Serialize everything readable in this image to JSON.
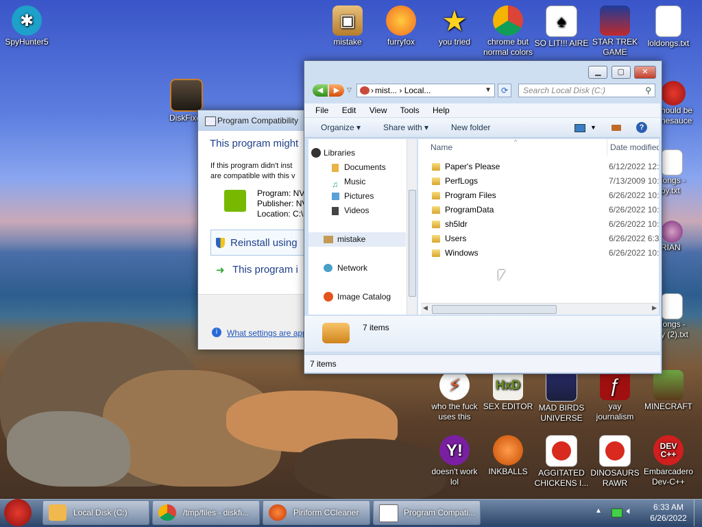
{
  "desktop_icons": {
    "spyhunter": "SpyHunter5",
    "diskfixer": "DiskFixer",
    "mistake": "mistake",
    "furryfox": "furryfox",
    "you_tried": "you tried",
    "chrome": "chrome but\nnormal colors",
    "solitaire": "SO LIT!!! AIRE",
    "star_trek": "STAR TREK\nGAME",
    "loldongs": "loldongs.txt",
    "should_be": "hould be\nnesauce",
    "loldongs_copy": "longs -\npy.txt",
    "brian": "RIAN",
    "loldongs_copy2": "longs -\ny (2).txt",
    "who_fuck": "who the fuck\nuses this",
    "sex_editor": "SEX EDITOR",
    "mad_birds": "MAD BIRDS\nUNIVERSE",
    "yay": "yay\njournalism",
    "minecraft": "MINECRAFT",
    "doesnt_work": "doesn't work\nlol",
    "inkballs": "INKBALLS",
    "aggitated": "AGGITATED\nCHICKENS I...",
    "dinosaurs": "DINOSAURS\nRAWR",
    "devcpp": "Embarcadero\nDev-C++",
    "devcpp_logo": "DEV\nC++"
  },
  "compat": {
    "title": "Program Compatibility",
    "heading": "This program might",
    "desc": "If this program didn't inst\nare compatible with this v",
    "program": "Program: NV",
    "publisher": "Publisher: NV",
    "location": "Location: C:\\",
    "reinstall": "Reinstall using",
    "installed": "This program i",
    "settings_link": "What settings are app"
  },
  "explorer": {
    "address": [
      "mist...",
      "Local..."
    ],
    "search_placeholder": "Search Local Disk (C:)",
    "menu": [
      "File",
      "Edit",
      "View",
      "Tools",
      "Help"
    ],
    "toolbar": {
      "organize": "Organize",
      "share": "Share with",
      "newfolder": "New folder"
    },
    "nav": {
      "libraries": "Libraries",
      "documents": "Documents",
      "music": "Music",
      "pictures": "Pictures",
      "videos": "Videos",
      "mistake": "mistake",
      "network": "Network",
      "catalog": "Image Catalog"
    },
    "columns": {
      "name": "Name",
      "date": "Date modified"
    },
    "files": [
      {
        "name": "Paper's Please",
        "date": "6/12/2022 12:"
      },
      {
        "name": "PerfLogs",
        "date": "7/13/2009 10:"
      },
      {
        "name": "Program Files",
        "date": "6/26/2022 10:"
      },
      {
        "name": "ProgramData",
        "date": "6/26/2022 10:"
      },
      {
        "name": "sh5ldr",
        "date": "6/26/2022 10:"
      },
      {
        "name": "Users",
        "date": "6/26/2022 6:3"
      },
      {
        "name": "Windows",
        "date": "6/26/2022 10:"
      }
    ],
    "details_count": "7 items",
    "status": "7 items"
  },
  "taskbar": {
    "items": [
      "Local Disk (C:)",
      "/tmp/files - diskfi...",
      "Piriform CCleaner",
      "Program Compati..."
    ],
    "time": "6:33 AM",
    "date": "6/26/2022"
  }
}
